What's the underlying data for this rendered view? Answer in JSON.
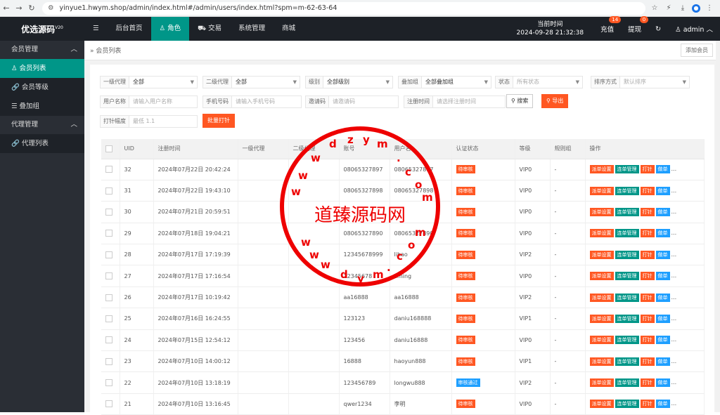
{
  "browser": {
    "url": "yinyue1.hwym.shop/admin/index.html#/admin/users/index.html?spm=m-62-63-64"
  },
  "header": {
    "logo": "优选源码",
    "logo_sup": "V20",
    "nav": [
      "后台首页",
      "角色",
      "交易",
      "系统管理",
      "商城"
    ],
    "time_label": "当前时间",
    "time_value": "2024-09-28 21:32:38",
    "recharge": "充值",
    "recharge_badge": "14",
    "withdraw": "提现",
    "withdraw_badge": "0",
    "user": "admin"
  },
  "sidebar": {
    "groups": [
      {
        "label": "会员管理",
        "items": [
          "会员列表",
          "会员等级",
          "叠加组"
        ]
      },
      {
        "label": "代理管理",
        "items": [
          "代理列表"
        ]
      }
    ]
  },
  "breadcrumb": "» 会员列表",
  "add_member": "添加会员",
  "filters": {
    "agent1": {
      "label": "一级代理",
      "value": "全部"
    },
    "agent2": {
      "label": "二级代理",
      "value": "全部"
    },
    "level": {
      "label": "级别",
      "value": "全部级别"
    },
    "stack": {
      "label": "叠加组",
      "value": "全部叠加组"
    },
    "status": {
      "label": "状态",
      "placeholder": "所有状态"
    },
    "sort": {
      "label": "排序方式",
      "placeholder": "默认排序"
    },
    "username": {
      "label": "用户名称",
      "placeholder": "请输入用户名称"
    },
    "phone": {
      "label": "手机号码",
      "placeholder": "请输入手机号码"
    },
    "invite": {
      "label": "邀请码",
      "placeholder": "请邀请码"
    },
    "regtime": {
      "label": "注册时间",
      "placeholder": "请选择注册时间"
    },
    "search": "搜索",
    "export": "导出",
    "punch": {
      "label": "打针幅度",
      "placeholder": "最低 1.1"
    },
    "batch": "批量打针"
  },
  "table": {
    "headers": [
      "UID",
      "注册时间",
      "一级代理",
      "二级代理",
      "账号",
      "用户名",
      "认证状态",
      "等级",
      "规则组",
      "操作"
    ],
    "actions": [
      "派单设置",
      "连单管理",
      "打针",
      "做单",
      "..."
    ],
    "rows": [
      [
        "32",
        "2024年07月22日 20:42:24",
        "",
        "",
        "08065327897",
        "08065327897",
        "待审核",
        "VIP0",
        "-"
      ],
      [
        "31",
        "2024年07月22日 19:43:10",
        "",
        "",
        "08065327898",
        "08065327898",
        "待审核",
        "VIP0",
        "-"
      ],
      [
        "30",
        "2024年07月21日 20:59:51",
        "",
        "",
        "",
        "",
        "待审核",
        "VIP0",
        "-"
      ],
      [
        "29",
        "2024年07月18日 19:04:21",
        "",
        "",
        "08065327890",
        "08065327890",
        "待审核",
        "VIP0",
        "-"
      ],
      [
        "28",
        "2024年07月17日 17:19:39",
        "",
        "",
        "12345678999",
        "lihao",
        "待审核",
        "VIP2",
        "-"
      ],
      [
        "27",
        "2024年07月17日 17:16:54",
        "",
        "",
        "12345678",
        "liming",
        "待审核",
        "VIP0",
        "-"
      ],
      [
        "26",
        "2024年07月17日 10:19:42",
        "",
        "",
        "aa16888",
        "aa16888",
        "待审核",
        "VIP2",
        "-"
      ],
      [
        "25",
        "2024年07月16日 16:24:55",
        "",
        "",
        "123123",
        "daniu168888",
        "待审核",
        "VIP1",
        "-"
      ],
      [
        "24",
        "2024年07月15日 12:54:12",
        "",
        "",
        "123456",
        "daniu16888",
        "待审核",
        "VIP0",
        "-"
      ],
      [
        "23",
        "2024年07月10日 14:00:12",
        "",
        "",
        "16888",
        "haoyun888",
        "待审核",
        "VIP1",
        "-"
      ],
      [
        "22",
        "2024年07月10日 13:18:19",
        "",
        "",
        "123456789",
        "longwu888",
        "审核通过",
        "VIP2",
        "-"
      ],
      [
        "21",
        "2024年07月10日 13:16:45",
        "",
        "",
        "qwer1234",
        "李明",
        "待审核",
        "VIP0",
        "-"
      ]
    ]
  },
  "watermark": {
    "text": "道臻源码网",
    "url_letters": "www.dzym.com"
  }
}
